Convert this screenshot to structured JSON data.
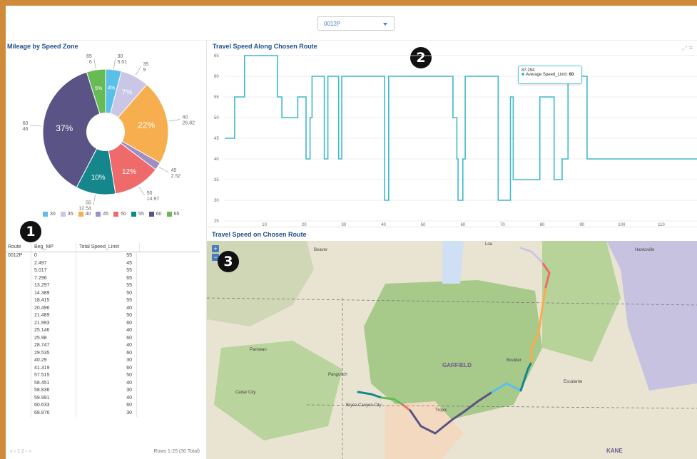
{
  "header": {
    "route_select_value": "0012P"
  },
  "pie_panel": {
    "title": "Mileage by Speed Zone",
    "slice_labels": [
      {
        "speed": "30",
        "miles": "5.01",
        "pct": "4%"
      },
      {
        "speed": "35",
        "miles": "9",
        "pct": "7%"
      },
      {
        "speed": "40",
        "miles": "26.82",
        "pct": "22%"
      },
      {
        "speed": "45",
        "miles": "2.52",
        "pct": ""
      },
      {
        "speed": "50",
        "miles": "14.97",
        "pct": "12%"
      },
      {
        "speed": "55",
        "miles": "12.54",
        "pct": "10%"
      },
      {
        "speed": "60",
        "miles": "46",
        "pct": "37%"
      },
      {
        "speed": "65",
        "miles": "6",
        "pct": "5%"
      }
    ],
    "legend": [
      {
        "label": "30",
        "color": "#5bc0e8"
      },
      {
        "label": "35",
        "color": "#c9c6e6"
      },
      {
        "label": "40",
        "color": "#f6ae4e"
      },
      {
        "label": "45",
        "color": "#9e8fc6"
      },
      {
        "label": "50",
        "color": "#ef6b6b"
      },
      {
        "label": "55",
        "color": "#15878c"
      },
      {
        "label": "60",
        "color": "#5a5486"
      },
      {
        "label": "65",
        "color": "#66bb55"
      }
    ]
  },
  "chart_data": {
    "type": "line",
    "title": "Travel Speed Along Chosen Route",
    "series": [
      {
        "name": "Average Speed_Limit",
        "color": "#3fb9c9",
        "points": [
          [
            0,
            45
          ],
          [
            2.5,
            45
          ],
          [
            2.5,
            55
          ],
          [
            5,
            55
          ],
          [
            5,
            65
          ],
          [
            7.3,
            65
          ],
          [
            7.3,
            65
          ],
          [
            13.3,
            65
          ],
          [
            13.3,
            55
          ],
          [
            14.4,
            55
          ],
          [
            14.4,
            50
          ],
          [
            18.4,
            50
          ],
          [
            18.4,
            55
          ],
          [
            20.5,
            55
          ],
          [
            20.5,
            40
          ],
          [
            21.5,
            40
          ],
          [
            21.5,
            50
          ],
          [
            22,
            50
          ],
          [
            22,
            60
          ],
          [
            25.1,
            60
          ],
          [
            25.1,
            40
          ],
          [
            26,
            40
          ],
          [
            26,
            60
          ],
          [
            28.7,
            60
          ],
          [
            28.7,
            40
          ],
          [
            29.5,
            40
          ],
          [
            29.5,
            60
          ],
          [
            40.3,
            60
          ],
          [
            40.3,
            30
          ],
          [
            41.3,
            30
          ],
          [
            41.3,
            60
          ],
          [
            57.5,
            60
          ],
          [
            57.5,
            50
          ],
          [
            58.5,
            50
          ],
          [
            58.5,
            40
          ],
          [
            58.8,
            40
          ],
          [
            58.8,
            30
          ],
          [
            60,
            30
          ],
          [
            60,
            40
          ],
          [
            60.6,
            40
          ],
          [
            60.6,
            60
          ],
          [
            68.9,
            60
          ],
          [
            68.9,
            30
          ],
          [
            72,
            30
          ],
          [
            72,
            55
          ],
          [
            72.7,
            55
          ],
          [
            72.7,
            35
          ],
          [
            79.4,
            35
          ],
          [
            79.4,
            55
          ],
          [
            83,
            55
          ],
          [
            83,
            35
          ],
          [
            85,
            35
          ],
          [
            85,
            40
          ],
          [
            86.5,
            40
          ],
          [
            86.5,
            60
          ],
          [
            87.3,
            60
          ],
          [
            87.3,
            60
          ],
          [
            91.3,
            60
          ],
          [
            91.3,
            40
          ],
          [
            119,
            40
          ]
        ]
      }
    ],
    "ylim": [
      25,
      65
    ],
    "xlim": [
      0,
      119
    ],
    "x_ticks": [
      10,
      20,
      30,
      40,
      50,
      60,
      70,
      80,
      90,
      100,
      110
    ],
    "y_ticks": [
      25,
      30,
      35,
      40,
      45,
      50,
      55,
      60,
      65
    ],
    "tooltip": {
      "x": "87.294",
      "series": "Average Speed_Limit",
      "value": "60"
    }
  },
  "table_panel": {
    "columns": [
      "Route",
      "Beg_MP",
      "Total Speed_Limit"
    ],
    "route": "0012P",
    "rows": [
      [
        "0",
        "55"
      ],
      [
        "2.497",
        "45"
      ],
      [
        "5.017",
        "55"
      ],
      [
        "7.296",
        "65"
      ],
      [
        "13.297",
        "55"
      ],
      [
        "14.389",
        "50"
      ],
      [
        "18.415",
        "55"
      ],
      [
        "20.496",
        "40"
      ],
      [
        "21.489",
        "50"
      ],
      [
        "21.993",
        "60"
      ],
      [
        "25.146",
        "40"
      ],
      [
        "25.98",
        "60"
      ],
      [
        "28.747",
        "40"
      ],
      [
        "29.535",
        "60"
      ],
      [
        "40.29",
        "30"
      ],
      [
        "41.319",
        "60"
      ],
      [
        "57.515",
        "50"
      ],
      [
        "58.451",
        "40"
      ],
      [
        "58.836",
        "30"
      ],
      [
        "59.991",
        "40"
      ],
      [
        "60.633",
        "60"
      ],
      [
        "68.876",
        "30"
      ]
    ],
    "pager": "« ‹ 1 2 › »",
    "summary": "Rows 1-25 (30 Total)"
  },
  "map_panel": {
    "title": "Travel Speed on Chosen Route",
    "labels": [
      "GARFIELD",
      "KANE",
      "Panguitch",
      "Cedar City",
      "Escalante",
      "Loa",
      "Hanksville",
      "Bryce Canyon City",
      "Parowan",
      "Beaver",
      "Tropic",
      "Boulder"
    ],
    "zoom_in": "+",
    "zoom_out": "−"
  },
  "badges": [
    "1",
    "2",
    "3"
  ]
}
